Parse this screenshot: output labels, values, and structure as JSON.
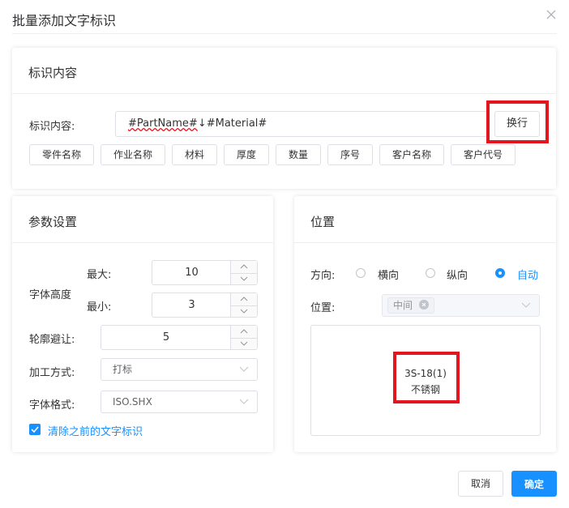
{
  "dialog": {
    "title": "批量添加文字标识"
  },
  "mark_content": {
    "section_title": "标识内容",
    "field_label": "标识内容:",
    "value_part1": "#PartName#",
    "value_part2": "↓#Material#",
    "newline_button": "换行",
    "tag_buttons": [
      "零件名称",
      "作业名称",
      "材料",
      "厚度",
      "数量",
      "序号",
      "客户名称",
      "客户代号"
    ]
  },
  "params": {
    "section_title": "参数设置",
    "font_height_label": "字体高度",
    "max_label": "最大:",
    "max_value": "10",
    "min_label": "最小:",
    "min_value": "3",
    "contour_avoid_label": "轮廓避让:",
    "contour_avoid_value": "5",
    "process_label": "加工方式:",
    "process_value": "打标",
    "font_format_label": "字体格式:",
    "font_format_value": "ISO.SHX",
    "clear_checkbox_label": "清除之前的文字标识",
    "clear_checked": true
  },
  "position": {
    "section_title": "位置",
    "direction_label": "方向:",
    "direction_options": [
      "横向",
      "纵向",
      "自动"
    ],
    "direction_selected": "自动",
    "position_label": "位置:",
    "position_tag": "中间",
    "preview_line1": "3S-18(1)",
    "preview_line2": "不锈钢"
  },
  "footer": {
    "cancel_label": "取消",
    "confirm_label": "确定"
  },
  "colors": {
    "primary": "#1890ff",
    "highlight": "#e3161f",
    "border": "#dcdfe6"
  }
}
